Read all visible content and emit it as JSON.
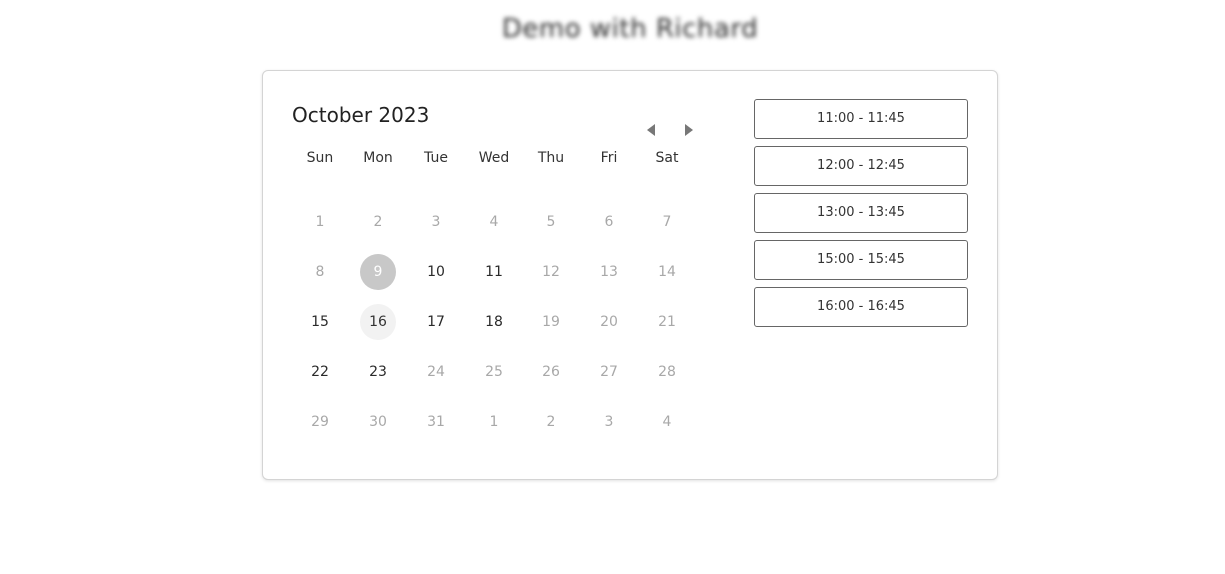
{
  "page": {
    "title": "Demo with Richard"
  },
  "calendar": {
    "month_label": "October 2023",
    "prev_icon": "caret-left-icon",
    "next_icon": "caret-right-icon",
    "weekdays": [
      "Sun",
      "Mon",
      "Tue",
      "Wed",
      "Thu",
      "Fri",
      "Sat"
    ],
    "selected_day": "9",
    "weeks": [
      [
        {
          "label": "1",
          "state": "muted"
        },
        {
          "label": "2",
          "state": "muted"
        },
        {
          "label": "3",
          "state": "muted"
        },
        {
          "label": "4",
          "state": "muted"
        },
        {
          "label": "5",
          "state": "muted"
        },
        {
          "label": "6",
          "state": "muted"
        },
        {
          "label": "7",
          "state": "muted"
        }
      ],
      [
        {
          "label": "8",
          "state": "muted"
        },
        {
          "label": "9",
          "state": "selected"
        },
        {
          "label": "10",
          "state": "active"
        },
        {
          "label": "11",
          "state": "active"
        },
        {
          "label": "12",
          "state": "muted"
        },
        {
          "label": "13",
          "state": "muted"
        },
        {
          "label": "14",
          "state": "muted"
        }
      ],
      [
        {
          "label": "15",
          "state": "active"
        },
        {
          "label": "16",
          "state": "hover"
        },
        {
          "label": "17",
          "state": "active"
        },
        {
          "label": "18",
          "state": "active"
        },
        {
          "label": "19",
          "state": "muted"
        },
        {
          "label": "20",
          "state": "muted"
        },
        {
          "label": "21",
          "state": "muted"
        }
      ],
      [
        {
          "label": "22",
          "state": "active"
        },
        {
          "label": "23",
          "state": "active"
        },
        {
          "label": "24",
          "state": "muted"
        },
        {
          "label": "25",
          "state": "muted"
        },
        {
          "label": "26",
          "state": "muted"
        },
        {
          "label": "27",
          "state": "muted"
        },
        {
          "label": "28",
          "state": "muted"
        }
      ],
      [
        {
          "label": "29",
          "state": "muted"
        },
        {
          "label": "30",
          "state": "muted"
        },
        {
          "label": "31",
          "state": "muted"
        },
        {
          "label": "1",
          "state": "muted"
        },
        {
          "label": "2",
          "state": "muted"
        },
        {
          "label": "3",
          "state": "muted"
        },
        {
          "label": "4",
          "state": "muted"
        }
      ]
    ]
  },
  "time_slots": [
    "11:00 - 11:45",
    "12:00 - 12:45",
    "13:00 - 13:45",
    "15:00 - 15:45",
    "16:00 - 16:45"
  ],
  "colors": {
    "selected_bg": "#c8c8c8",
    "hover_bg": "#f2f2f2",
    "muted_text": "#a8a8a8",
    "active_text": "#2a2a2a",
    "slot_border": "#666666"
  }
}
